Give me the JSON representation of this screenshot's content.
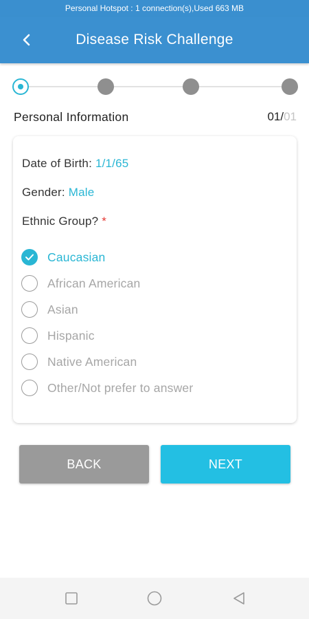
{
  "status_bar": {
    "text": "Personal Hotspot : 1 connection(s),Used  663 MB"
  },
  "header": {
    "title": "Disease Risk Challenge",
    "back_icon": "chevron-left-icon"
  },
  "stepper": {
    "total_steps": 4,
    "current_step": 1
  },
  "section": {
    "title": "Personal Information",
    "count_current": "01/",
    "count_total": "01"
  },
  "form": {
    "dob_label": "Date of Birth: ",
    "dob_value": "1/1/65",
    "gender_label": "Gender: ",
    "gender_value": "Male",
    "ethnic_label": "Ethnic Group? ",
    "required_mark": "*",
    "options": [
      {
        "label": "Caucasian",
        "selected": true
      },
      {
        "label": "African American",
        "selected": false
      },
      {
        "label": "Asian",
        "selected": false
      },
      {
        "label": "Hispanic",
        "selected": false
      },
      {
        "label": "Native American",
        "selected": false
      },
      {
        "label": "Other/Not prefer to answer",
        "selected": false
      }
    ]
  },
  "buttons": {
    "back": "BACK",
    "next": "NEXT"
  },
  "colors": {
    "header": "#3b90d0",
    "accent": "#29b6d4",
    "next_button": "#23bfe3",
    "back_button": "#9a9a9a"
  },
  "navbar": {
    "icons": [
      "recent-apps-icon",
      "home-icon",
      "back-triangle-icon"
    ]
  }
}
